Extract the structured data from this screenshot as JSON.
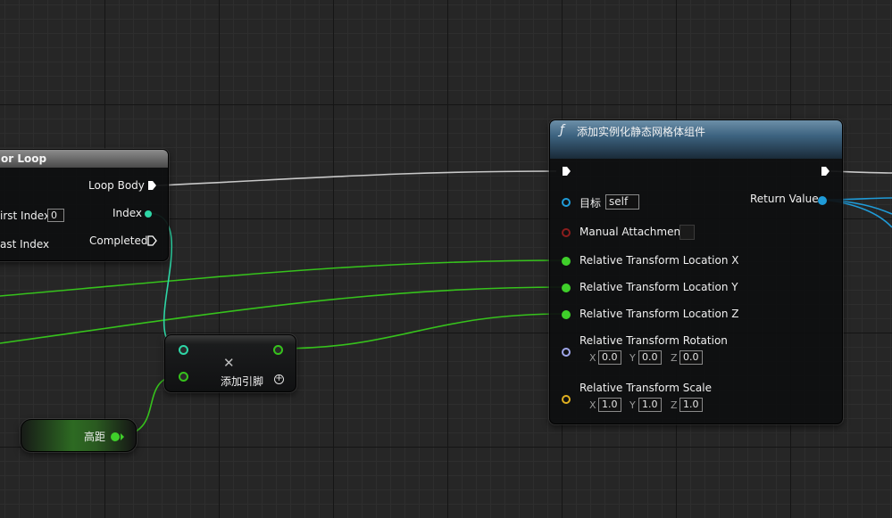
{
  "colors": {
    "float_pin": "#3fcf2a",
    "int_pin": "#2ed6a6",
    "object_pin": "#1f9bd8",
    "bool_pin": "#8b1d1d",
    "rotator_pin": "#9fa6e8",
    "vector_pin": "#e0b020",
    "exec_pin": "#ffffff"
  },
  "for_loop": {
    "title": "or Loop",
    "pins": {
      "loop_body": "Loop Body",
      "first_index": "irst Index",
      "first_index_value": "0",
      "index": "Index",
      "last_index": "ast Index",
      "completed": "Completed"
    }
  },
  "make_array": {
    "add_pin_label": "添加引脚",
    "remove_icon": "✕"
  },
  "variable_node": {
    "label": "高距"
  },
  "function_node": {
    "icon": "ƒ",
    "title": "添加实例化静态网格体组件",
    "target_label": "目标",
    "target_value": "self",
    "manual_attachment": "Manual Attachment",
    "location_x": "Relative Transform Location X",
    "location_y": "Relative Transform Location Y",
    "location_z": "Relative Transform Location Z",
    "rotation": "Relative Transform Rotation",
    "rotation_values": {
      "x": "0.0",
      "y": "0.0",
      "z": "0.0"
    },
    "scale": "Relative Transform Scale",
    "scale_values": {
      "x": "1.0",
      "y": "1.0",
      "z": "1.0"
    },
    "return_value": "Return Value",
    "axis_labels": {
      "x": "X",
      "y": "Y",
      "z": "Z"
    }
  }
}
